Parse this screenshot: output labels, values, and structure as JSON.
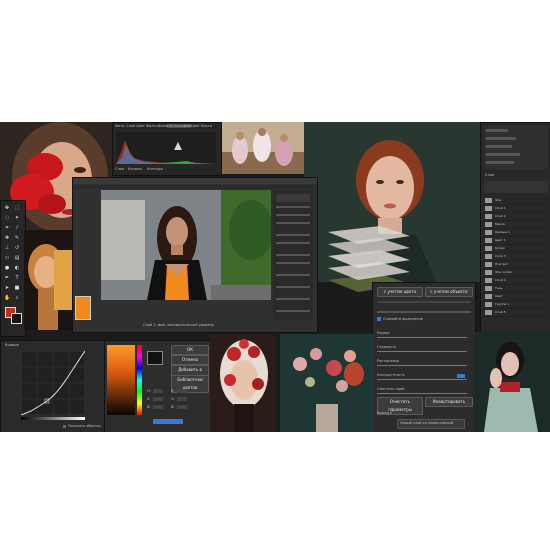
{
  "histogram_panel": {
    "menu": [
      "Фото",
      "Слой",
      "Цвет",
      "Фильтр",
      "Окно",
      "Гистограмма",
      "Цвет",
      "Кисти"
    ],
    "tabs": [
      "Слои",
      "Каналы",
      "Контуры"
    ]
  },
  "main_window": {
    "status_text": "Слой 1, фон, автоматический уровень"
  },
  "layers_panel": {
    "title": "Слои",
    "rows": [
      "Фон",
      "Слой 1",
      "Слой 2",
      "Маска",
      "Кривые 1",
      "Цвет 1",
      "Копия",
      "Слой 3",
      "Портрет",
      "Фон копия",
      "Слой 4",
      "Тень",
      "Свет",
      "Группа 1",
      "Слой 5"
    ]
  },
  "adjustments_panel": {
    "mode_buttons": [
      "с учетом цвета",
      "с учетом объекта"
    ],
    "checkbox_label": "Снимайте выделение",
    "slider_labels": [
      "Радиус",
      "Гладкость",
      "Растушевка",
      "Контрастность",
      "Сместить край"
    ],
    "button_refine": "Очистить параметры",
    "button_invert": "Инвертировать",
    "output_label": "Вывод в",
    "output_value": "Новый слой со слоем-маской"
  },
  "curves_panel": {
    "title": "Кривые",
    "checkbox_label": "Показать обрезку"
  },
  "color_picker": {
    "button_ok": "ОК",
    "button_cancel": "Отмена",
    "button_add_swatch": "Добавить в образцы",
    "button_libraries": "Библиотеки цветов",
    "field_labels": [
      "H:",
      "S:",
      "B:",
      "R:",
      "G:",
      "B:"
    ]
  },
  "colors": {
    "panel_bg": "#2b2b2b",
    "accent_blue": "#3a78d8",
    "orange": "#f08a1c"
  }
}
